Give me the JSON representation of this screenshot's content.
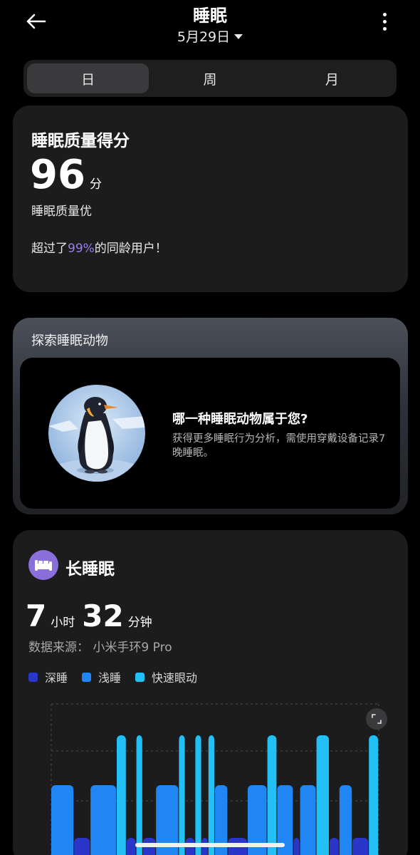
{
  "header": {
    "title": "睡眠",
    "date": "5月29日",
    "back_icon": "arrow-left-icon",
    "more_icon": "more-vertical-icon"
  },
  "tabs": [
    {
      "label": "日",
      "active": true
    },
    {
      "label": "周",
      "active": false
    },
    {
      "label": "月",
      "active": false
    }
  ],
  "score_card": {
    "title": "睡眠质量得分",
    "score": "96",
    "unit": "分",
    "quality": "睡眠质量优",
    "percent_prefix": "超过了",
    "percent": "99%",
    "percent_suffix": "的同龄用户！"
  },
  "explore_card": {
    "title": "探索睡眠动物",
    "question": "哪一种睡眠动物属于您?",
    "description": "获得更多睡眠行为分析，需使用穿戴设备记录7晚睡眠。",
    "image_icon": "penguin-illustration"
  },
  "sleep_card": {
    "title": "长睡眠",
    "icon": "bed-icon",
    "hours": "7",
    "hours_unit": "小时",
    "minutes": "32",
    "minutes_unit": "分钟",
    "source": "数据来源： 小米手环9 Pro",
    "legend": [
      {
        "label": "深睡",
        "color": "#2a35c9"
      },
      {
        "label": "浅睡",
        "color": "#1f86f3"
      },
      {
        "label": "快速眼动",
        "color": "#22c0f5"
      }
    ],
    "expand_icon": "expand-icon"
  },
  "colors": {
    "accent": "#9b7ee8",
    "deep": "#2a35c9",
    "light": "#1f86f3",
    "rem": "#22c0f5"
  },
  "chart_data": {
    "type": "area",
    "stage_levels": {
      "rem": 1,
      "light": 2,
      "deep": 3
    },
    "segments": [
      {
        "stage": "light",
        "start": 0,
        "end": 0.07
      },
      {
        "stage": "deep",
        "start": 0.07,
        "end": 0.12
      },
      {
        "stage": "light",
        "start": 0.12,
        "end": 0.2
      },
      {
        "stage": "rem",
        "start": 0.2,
        "end": 0.23
      },
      {
        "stage": "deep",
        "start": 0.23,
        "end": 0.26
      },
      {
        "stage": "rem",
        "start": 0.26,
        "end": 0.28
      },
      {
        "stage": "deep",
        "start": 0.28,
        "end": 0.32
      },
      {
        "stage": "light",
        "start": 0.32,
        "end": 0.39
      },
      {
        "stage": "rem",
        "start": 0.39,
        "end": 0.41
      },
      {
        "stage": "deep",
        "start": 0.41,
        "end": 0.44
      },
      {
        "stage": "rem",
        "start": 0.44,
        "end": 0.46
      },
      {
        "stage": "deep",
        "start": 0.46,
        "end": 0.48
      },
      {
        "stage": "rem",
        "start": 0.48,
        "end": 0.5
      },
      {
        "stage": "light",
        "start": 0.5,
        "end": 0.54
      },
      {
        "stage": "deep",
        "start": 0.54,
        "end": 0.6
      },
      {
        "stage": "light",
        "start": 0.6,
        "end": 0.66
      },
      {
        "stage": "rem",
        "start": 0.66,
        "end": 0.69
      },
      {
        "stage": "light",
        "start": 0.69,
        "end": 0.74
      },
      {
        "stage": "deep",
        "start": 0.74,
        "end": 0.76
      },
      {
        "stage": "light",
        "start": 0.76,
        "end": 0.81
      },
      {
        "stage": "rem",
        "start": 0.81,
        "end": 0.85
      },
      {
        "stage": "deep",
        "start": 0.85,
        "end": 0.88
      },
      {
        "stage": "light",
        "start": 0.88,
        "end": 0.92
      },
      {
        "stage": "deep",
        "start": 0.92,
        "end": 0.97
      },
      {
        "stage": "rem",
        "start": 0.97,
        "end": 1.0
      }
    ]
  }
}
